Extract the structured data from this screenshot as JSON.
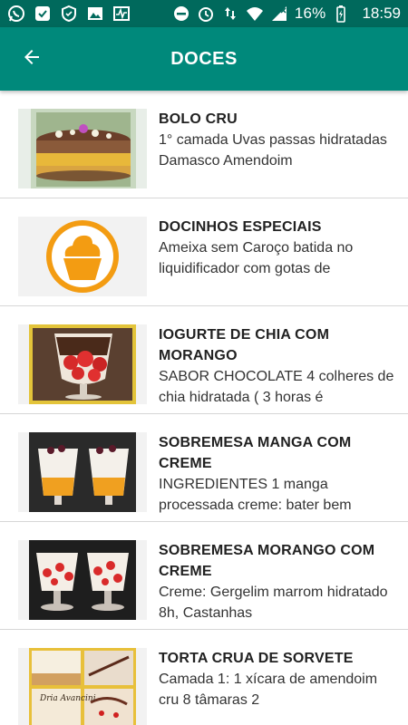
{
  "status_bar": {
    "icons_left": [
      "whatsapp-icon",
      "shield-check-icon",
      "shield-icon",
      "image-icon",
      "activity-icon"
    ],
    "icons_right": [
      "do-not-disturb-icon",
      "alarm-icon",
      "data-arrows-icon",
      "wifi-icon",
      "signal-icon"
    ],
    "battery": "16%",
    "time": "18:59"
  },
  "app_bar": {
    "title": "DOCES",
    "color": "#00897b",
    "status_color": "#00695c"
  },
  "items": [
    {
      "title": "BOLO CRU",
      "description": "1° camada Uvas passas hidratadas Damasco Amendoim",
      "image": "cake-photo"
    },
    {
      "title": "DOCINHOS ESPECIAIS",
      "description": "Ameixa sem Caroço  batida no liquidificador com gotas de",
      "image": "cupcake-icon"
    },
    {
      "title": "IOGURTE DE CHIA COM MORANGO",
      "description": "SABOR CHOCOLATE 4 colheres de chia hidratada ( 3 horas é",
      "image": "strawberry-yogurt-photo"
    },
    {
      "title": "SOBREMESA MANGA COM CREME",
      "description": "INGREDIENTES 1 manga processada creme: bater bem",
      "image": "mango-dessert-photo"
    },
    {
      "title": "SOBREMESA MORANGO COM CREME",
      "description": "Creme: Gergelim marrom hidratado 8h,  Castanhas",
      "image": "strawberry-dessert-photo"
    },
    {
      "title": "TORTA CRUA DE SORVETE",
      "description": "Camada 1: 1 xícara de amendoim cru 8 tâmaras 2",
      "image": "ice-cream-pie-photo",
      "caption": "Dria Avancini"
    }
  ]
}
